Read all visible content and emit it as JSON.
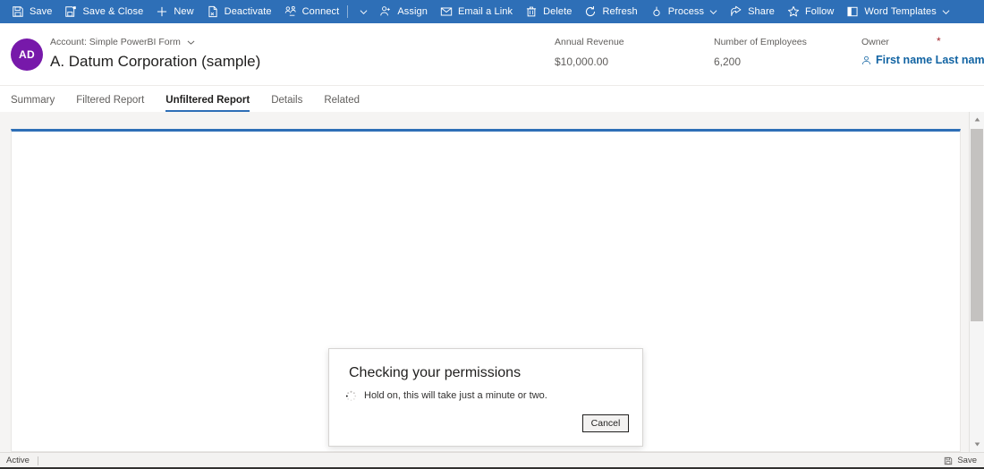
{
  "command_bar": {
    "background_color": "#2e6fb7",
    "items": [
      {
        "icon": "save-icon",
        "label": "Save",
        "has_chevron": false
      },
      {
        "icon": "save-close-icon",
        "label": "Save & Close",
        "has_chevron": false
      },
      {
        "icon": "plus-icon",
        "label": "New",
        "has_chevron": false
      },
      {
        "icon": "deactivate-icon",
        "label": "Deactivate",
        "has_chevron": false
      },
      {
        "icon": "connect-icon",
        "label": "Connect",
        "has_chevron": true
      },
      {
        "icon": "assign-icon",
        "label": "Assign",
        "has_chevron": false
      },
      {
        "icon": "email-link-icon",
        "label": "Email a Link",
        "has_chevron": false
      },
      {
        "icon": "delete-icon",
        "label": "Delete",
        "has_chevron": false
      },
      {
        "icon": "refresh-icon",
        "label": "Refresh",
        "has_chevron": false
      },
      {
        "icon": "process-icon",
        "label": "Process",
        "has_chevron": true
      },
      {
        "icon": "share-icon",
        "label": "Share",
        "has_chevron": false
      },
      {
        "icon": "follow-star-icon",
        "label": "Follow",
        "has_chevron": false
      },
      {
        "icon": "word-templates-icon",
        "label": "Word Templates",
        "has_chevron": true
      }
    ]
  },
  "record_header": {
    "avatar_initials": "AD",
    "avatar_color": "#7719aa",
    "form_selector_label": "Account: Simple PowerBI Form",
    "record_title": "A. Datum Corporation (sample)",
    "fields": {
      "annual_revenue": {
        "label": "Annual Revenue",
        "value": "$10,000.00"
      },
      "employees": {
        "label": "Number of Employees",
        "value": "6,200"
      },
      "owner": {
        "label": "Owner",
        "value": "First name Last name",
        "required_marker": "*",
        "link_color": "#1264a3"
      }
    }
  },
  "tabs": {
    "items": [
      {
        "label": "Summary",
        "active": false
      },
      {
        "label": "Filtered Report",
        "active": false
      },
      {
        "label": "Unfiltered Report",
        "active": true
      },
      {
        "label": "Details",
        "active": false
      },
      {
        "label": "Related",
        "active": false
      }
    ],
    "accent_color": "#2e6fb7"
  },
  "dialog": {
    "title": "Checking your permissions",
    "message": "Hold on, this will take just a minute or two.",
    "spinner_icon": "loading-spinner-icon",
    "cancel_label": "Cancel"
  },
  "status_bar": {
    "state_label": "Active",
    "save_label": "Save",
    "save_icon": "save-icon"
  }
}
